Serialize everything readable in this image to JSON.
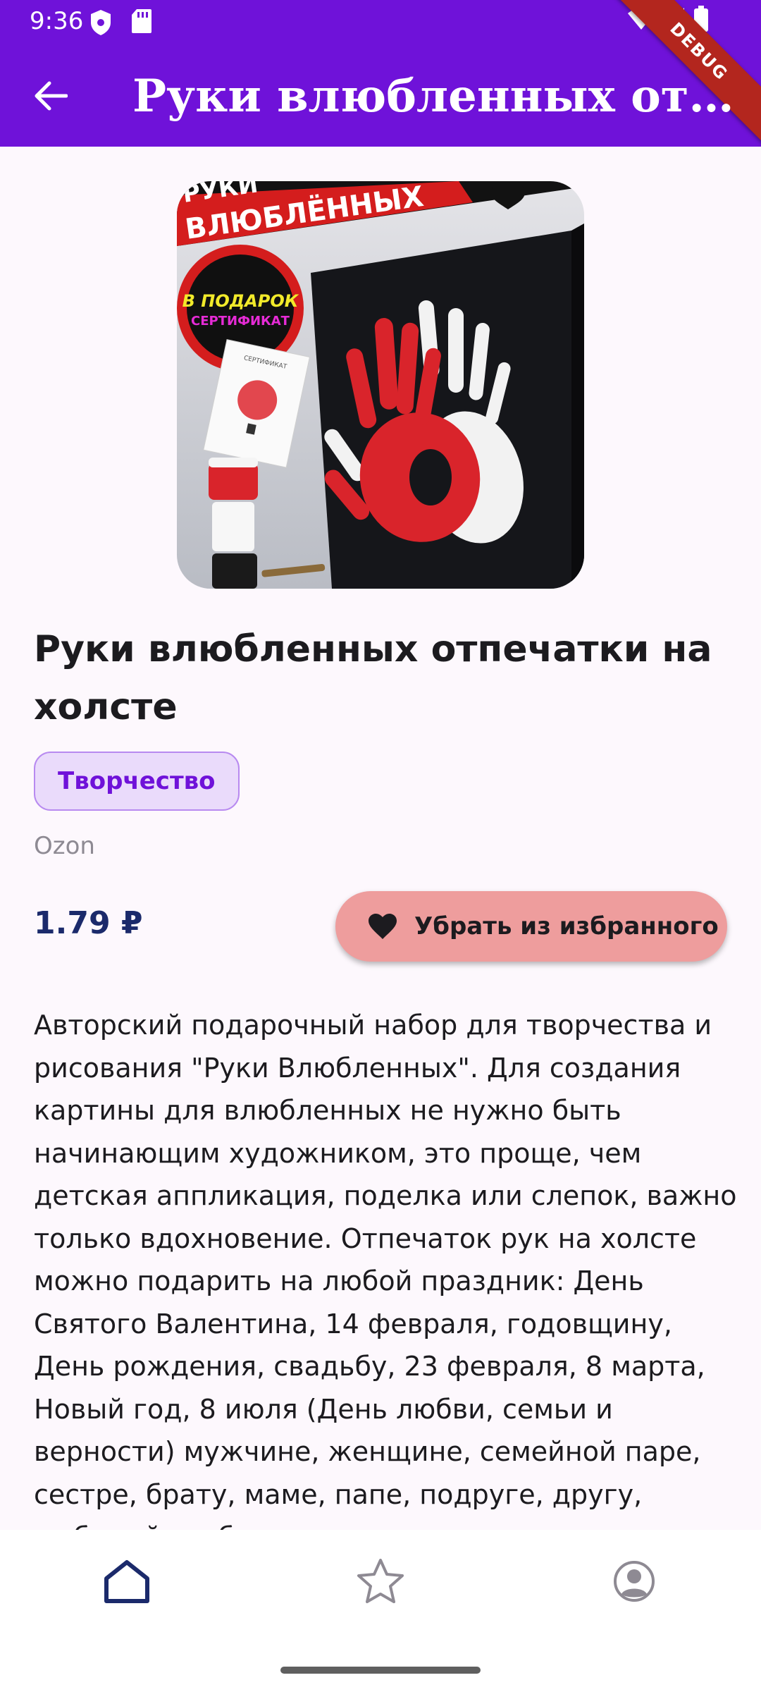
{
  "status_bar": {
    "time": "9:36",
    "debug_label": "DEBUG"
  },
  "app_bar": {
    "title": "Руки влюбленных отпечатки на холсте",
    "back_icon": "arrow-back-icon"
  },
  "product": {
    "image_alt": "Руки влюбленных отпечатки на холсте",
    "image_text": {
      "headline_top": "РУКИ",
      "headline_bottom": "ВЛЮБЛЁННЫХ",
      "badge_line1": "В ПОДАРОК",
      "badge_line2": "СЕРТИФИКАТ",
      "certificate_label": "СЕРТИФИКАТ"
    },
    "title": "Руки влюбленных отпечатки на холсте",
    "category": "Творчество",
    "store": "Ozon",
    "price": "1.79 ₽",
    "favorite_button_label": "Убрать из избранного",
    "description": "Авторский подарочный набор для творчества и рисования \"Руки Влюбленных\". Для создания картины для влюбленных не нужно быть начинающим художником, это проще, чем детская аппликация, поделка или слепок, важно только вдохновение. Отпечаток рук на холсте можно подарить на любой праздник: День Святого Валентина, 14 февраля, годовщину, День рождения, свадьбу, 23 февраля, 8 марта, Новый год, 8 июля (День любви, семьи и верности) мужчине, женщине, семейной паре, сестре, брату, маме, папе, подруге, другу, любимой, любимому."
  },
  "bottom_nav": {
    "items": [
      {
        "icon": "home-icon",
        "selected": true
      },
      {
        "icon": "star-icon",
        "selected": false
      },
      {
        "icon": "account-icon",
        "selected": false
      }
    ]
  },
  "colors": {
    "primary": "#6f12d9",
    "chip_bg": "#eadbfb",
    "favorite_button": "#ee9d9d",
    "price": "#1b2a6b"
  }
}
